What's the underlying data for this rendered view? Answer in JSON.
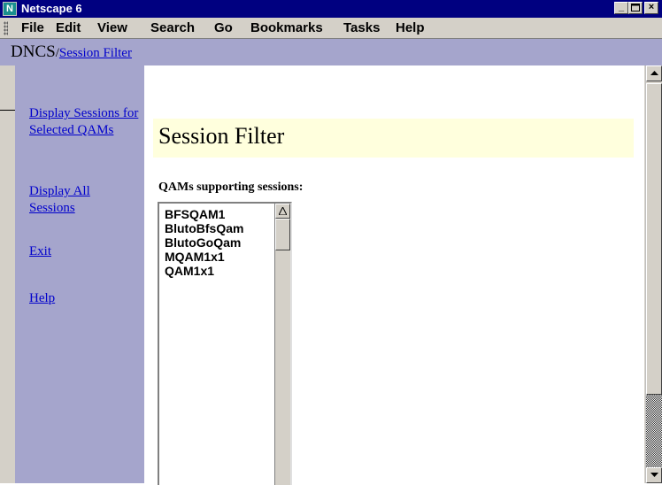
{
  "window": {
    "title": "Netscape 6",
    "app_icon": "netscape-icon",
    "controls": [
      "minimize-icon",
      "maximize-icon",
      "close-icon"
    ]
  },
  "menubar": {
    "items": [
      "File",
      "Edit",
      "View",
      "Search",
      "Go",
      "Bookmarks",
      "Tasks",
      "Help"
    ]
  },
  "header": {
    "brand": "DNCS",
    "separator": "/",
    "crumb": "Session Filter"
  },
  "sidebar": {
    "links": [
      "Display Sessions for Selected QAMs",
      "Display All Sessions",
      "Exit",
      "Help"
    ]
  },
  "page": {
    "title": "Session Filter",
    "list_label": "QAMs supporting sessions:",
    "qams": [
      "BFSQAM1",
      "BlutoBfsQam",
      "BlutoGoQam",
      "MQAM1x1",
      "QAM1x1"
    ]
  },
  "colors": {
    "titlebar": "#000080",
    "chrome": "#d4d0c8",
    "nav_background": "#a5a5cc",
    "banner_background": "#ffffdd",
    "link": "#0000cc"
  }
}
